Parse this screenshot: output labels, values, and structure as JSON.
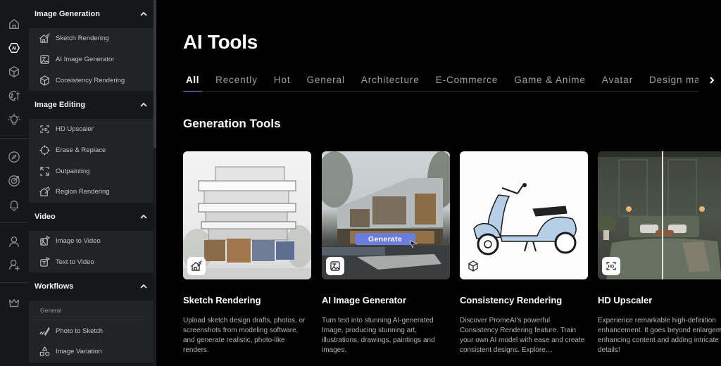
{
  "rail": {
    "icons": [
      "home-icon",
      "ai-icon",
      "cube-icon",
      "palette-icon",
      "lightbulb-icon",
      "compass-icon",
      "target-icon",
      "bell-icon",
      "user-icon",
      "user-add-icon",
      "crown-icon"
    ],
    "active": "ai-icon"
  },
  "sidebar": {
    "sections": [
      {
        "title": "Image Generation",
        "items": [
          {
            "label": "Sketch Rendering",
            "icon": "sketch-house-icon"
          },
          {
            "label": "AI Image Generator",
            "icon": "text-image-icon"
          },
          {
            "label": "Consistency Rendering",
            "icon": "cube-icon"
          }
        ]
      },
      {
        "title": "Image Editing",
        "items": [
          {
            "label": "HD Upscaler",
            "icon": "hd-icon"
          },
          {
            "label": "Erase & Replace",
            "icon": "erase-icon"
          },
          {
            "label": "Outpainting",
            "icon": "expand-icon"
          },
          {
            "label": "Region Rendering",
            "icon": "region-icon"
          }
        ]
      },
      {
        "title": "Video",
        "items": [
          {
            "label": "Image to Video",
            "icon": "image-video-icon"
          },
          {
            "label": "Text to Video",
            "icon": "text-video-icon"
          }
        ]
      },
      {
        "title": "Workflows",
        "subheader": "General",
        "items": [
          {
            "label": "Photo to Sketch",
            "icon": "pen-icon"
          },
          {
            "label": "Image Variation",
            "icon": "shapes-icon"
          }
        ]
      }
    ]
  },
  "main": {
    "title": "AI Tools",
    "tabs": [
      {
        "label": "All",
        "active": true
      },
      {
        "label": "Recently"
      },
      {
        "label": "Hot"
      },
      {
        "label": "General"
      },
      {
        "label": "Architecture"
      },
      {
        "label": "E-Commerce"
      },
      {
        "label": "Game & Anime"
      },
      {
        "label": "Avatar"
      },
      {
        "label": "Design mate"
      }
    ],
    "section_title": "Generation Tools",
    "cards": [
      {
        "title": "Sketch Rendering",
        "description": "Upload sketch design drafts, photos, or screenshots from modeling software, and generate realistic, photo-like renders.",
        "badge_icon": "sketch-house-icon"
      },
      {
        "title": "AI Image Generator",
        "description": "Turn text into stunning AI-generated Image, producing stunning art, illustrations, drawings, paintings and images.",
        "badge_icon": "text-image-icon",
        "overlay_button": "Generate"
      },
      {
        "title": "Consistency Rendering",
        "description": "Discover PromeAI's powerful Consistency Rendering feature. Train your own AI model with ease and create consistent designs. Explore…",
        "badge_icon": "cube-icon"
      },
      {
        "title": "HD Upscaler",
        "description": "Experience remarkable high-definition enhancement. It goes beyond enlargement, enhancing content and adding intricate details!",
        "badge_icon": "hd-icon"
      }
    ]
  },
  "colors": {
    "accent": "#6b74d8",
    "generate_button": "#6a7ee0",
    "sidebar_bg": "#16171b",
    "sidebar_section_bg": "#222327",
    "main_bg": "#000000"
  }
}
